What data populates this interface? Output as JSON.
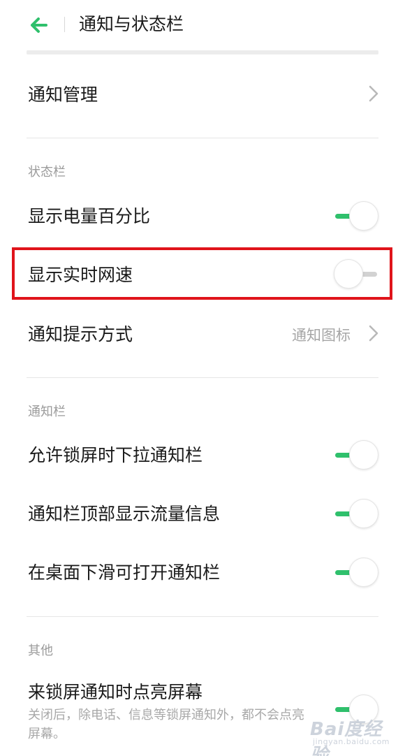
{
  "header": {
    "title": "通知与状态栏"
  },
  "notification_management": {
    "label": "通知管理"
  },
  "status_bar_section": {
    "title": "状态栏",
    "items": [
      {
        "label": "显示电量百分比",
        "toggle": "on"
      },
      {
        "label": "显示实时网速",
        "toggle": "off"
      }
    ],
    "notify_style": {
      "label": "通知提示方式",
      "value": "通知图标"
    }
  },
  "notification_bar_section": {
    "title": "通知栏",
    "items": [
      {
        "label": "允许锁屏时下拉通知栏",
        "toggle": "on"
      },
      {
        "label": "通知栏顶部显示流量信息",
        "toggle": "on"
      },
      {
        "label": "在桌面下滑可打开通知栏",
        "toggle": "on"
      }
    ]
  },
  "other_section": {
    "title": "其他",
    "items": [
      {
        "label": "来锁屏通知时点亮屏幕",
        "description": "关闭后，除电话、信息等锁屏通知外，都不会点亮屏幕。",
        "toggle": "on"
      }
    ]
  },
  "watermark": {
    "main": "Bai度经验",
    "sub": "jingyan.baidu.com"
  },
  "colors": {
    "accent": "#2fc06c",
    "highlight": "#e0141b"
  },
  "icons": {
    "back": "arrow-left-icon",
    "chevron": "chevron-right-icon"
  }
}
